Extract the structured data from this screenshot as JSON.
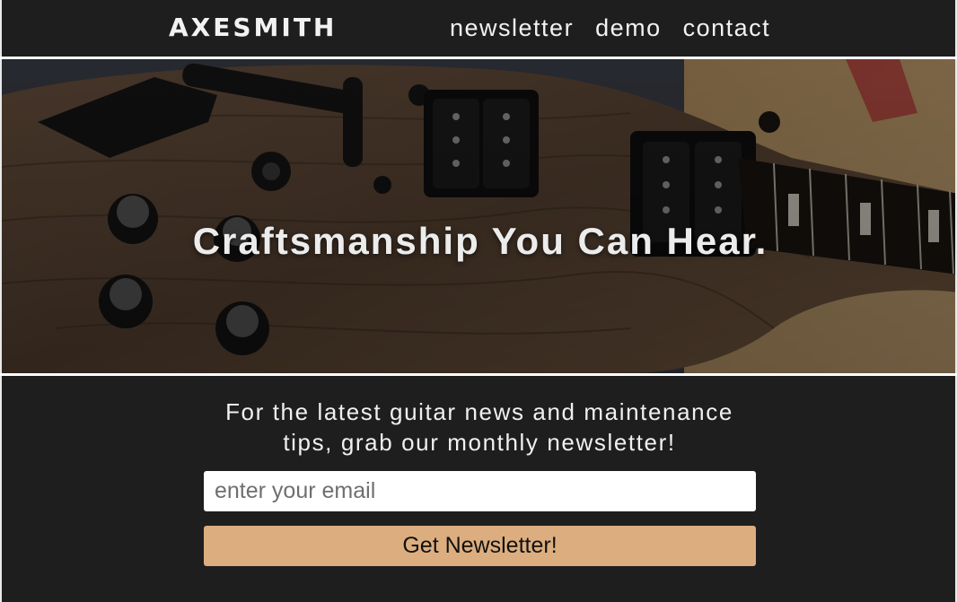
{
  "header": {
    "logo": "AXESMITH",
    "nav": [
      {
        "label": "newsletter"
      },
      {
        "label": "demo"
      },
      {
        "label": "contact"
      }
    ]
  },
  "hero": {
    "title": "Craftsmanship You Can Hear."
  },
  "signup": {
    "text": "For the latest guitar news and maintenance tips, grab our monthly newsletter!",
    "email_placeholder": "enter your email",
    "email_value": "",
    "button_label": "Get Newsletter!"
  },
  "colors": {
    "background": "#1e1e1e",
    "accent_button": "#dcae7f",
    "text_light": "#f0f0f0"
  }
}
